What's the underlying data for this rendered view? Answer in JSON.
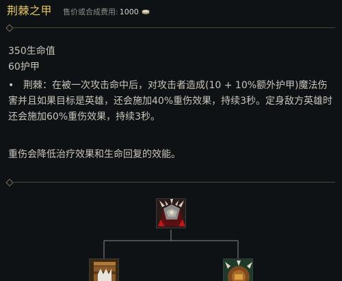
{
  "item": {
    "name": "荆棘之甲",
    "price_label": "售价或合成费用:",
    "price_value": "1000",
    "currency_icon": "gold-coins-icon"
  },
  "stats": {
    "health": "350生命值",
    "armor": "60护甲"
  },
  "passive": {
    "bullet": "•",
    "text": "荆棘：在被一次攻击命中后，对攻击者造成(10 + 10%额外护甲)魔法伤害并且如果目标是英雄，还会施加40%重伤效果，持续3秒。定身敌方英雄时还会施加60%重伤效果，持续3秒。"
  },
  "note": "重伤会降低治疗效果和生命回复的效能。",
  "recipe": {
    "top_item_icon": "thornmail-icon",
    "left_component_icon": "bramble-vest-icon",
    "right_component_icon": "giants-belt-icon"
  },
  "colors": {
    "background": "#0f1215",
    "item_name": "#e8c866",
    "body_text": "#c8c5bc",
    "divider": "#4a4638"
  }
}
